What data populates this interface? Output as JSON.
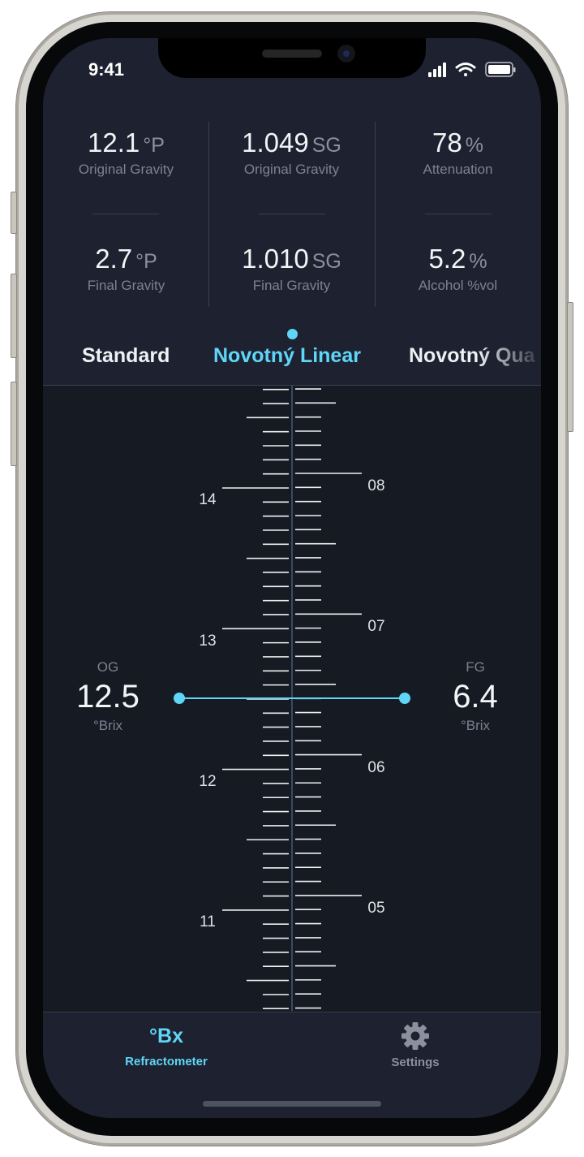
{
  "status_bar": {
    "time": "9:41"
  },
  "stats": [
    {
      "value": "12.1",
      "unit": "°P",
      "label": "Original Gravity"
    },
    {
      "value": "1.049",
      "unit": "SG",
      "label": "Original Gravity"
    },
    {
      "value": "78",
      "unit": "%",
      "label": "Attenuation"
    },
    {
      "value": "2.7",
      "unit": "°P",
      "label": "Final Gravity"
    },
    {
      "value": "1.010",
      "unit": "SG",
      "label": "Final Gravity"
    },
    {
      "value": "5.2",
      "unit": "%",
      "label": "Alcohol %vol"
    }
  ],
  "formula_tabs": {
    "items": [
      "Standard",
      "Novotný Linear",
      "Novotný Qua"
    ],
    "selected": "Novotný Linear"
  },
  "scale": {
    "left_labels": [
      "14",
      "13",
      "12",
      "11"
    ],
    "right_labels": [
      "08",
      "07",
      "06",
      "05"
    ]
  },
  "og": {
    "label": "OG",
    "value": "12.5",
    "unit": "°Brix"
  },
  "fg": {
    "label": "FG",
    "value": "6.4",
    "unit": "°Brix"
  },
  "nav": {
    "refractometer_icon": "°Bx",
    "refractometer_label": "Refractometer",
    "settings_label": "Settings",
    "active": "Refractometer"
  },
  "colors": {
    "accent": "#5fd6f8",
    "background": "#161a23",
    "panel": "#1e2230",
    "text": "#f3f4f6",
    "muted": "#7c8290"
  }
}
